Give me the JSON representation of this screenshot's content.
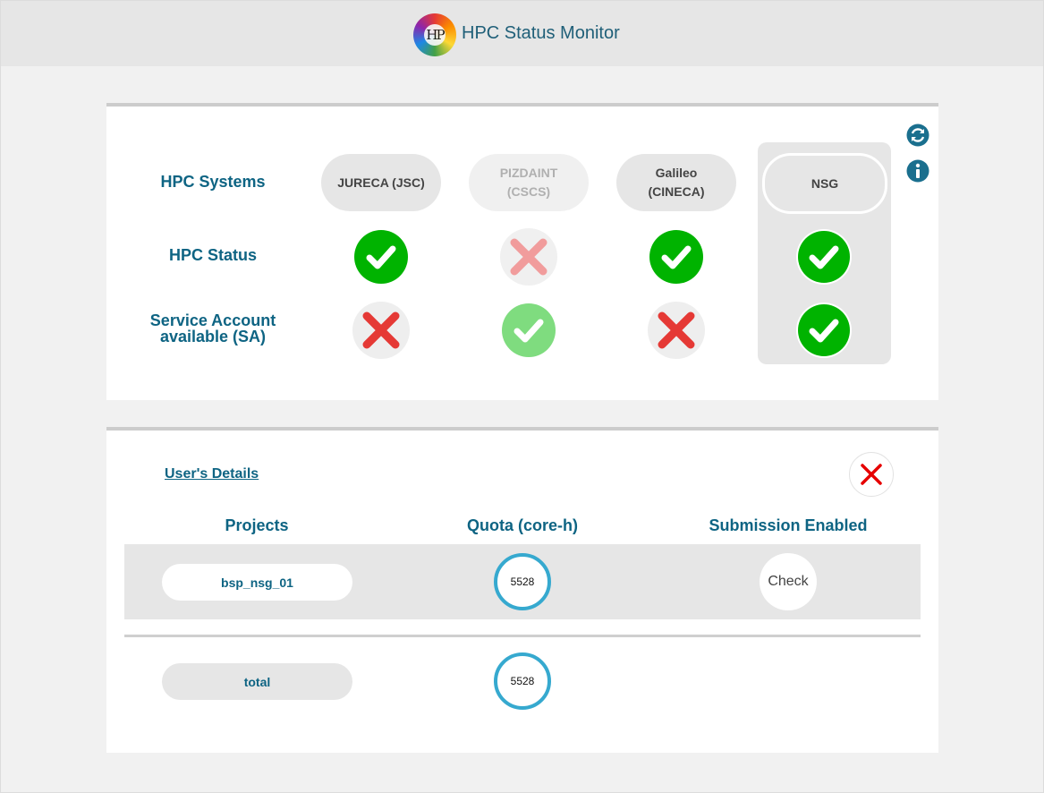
{
  "header": {
    "title": "HPC Status Monitor",
    "logo_text": "HP"
  },
  "systems": {
    "row_labels": {
      "systems": "HPC Systems",
      "status": "HPC Status",
      "service_account": "Service Account\navailable (SA)"
    },
    "items": [
      {
        "label": "JURECA (JSC)",
        "state": "normal",
        "hpc_status": "ok",
        "sa": "fail"
      },
      {
        "label": "PIZDAINT\n(CSCS)",
        "state": "disabled",
        "hpc_status": "fail",
        "sa": "ok"
      },
      {
        "label": "Galileo\n(CINECA)",
        "state": "normal",
        "hpc_status": "ok",
        "sa": "fail"
      },
      {
        "label": "NSG",
        "state": "selected",
        "hpc_status": "ok",
        "sa": "ok"
      }
    ],
    "side_icons": [
      "refresh-icon",
      "info-icon"
    ]
  },
  "user_details": {
    "link": "User's Details",
    "close_icon": "close-icon",
    "columns": [
      "Projects",
      "Quota (core-h)",
      "Submission Enabled"
    ],
    "rows": [
      {
        "project": "bsp_nsg_01",
        "quota": "5528",
        "action": "Check"
      }
    ],
    "total": {
      "label": "total",
      "quota": "5528"
    }
  },
  "colors": {
    "accent": "#0e6483",
    "ok": "#00b300",
    "fail": "#e53935",
    "quota_ring": "#36a9cf"
  }
}
